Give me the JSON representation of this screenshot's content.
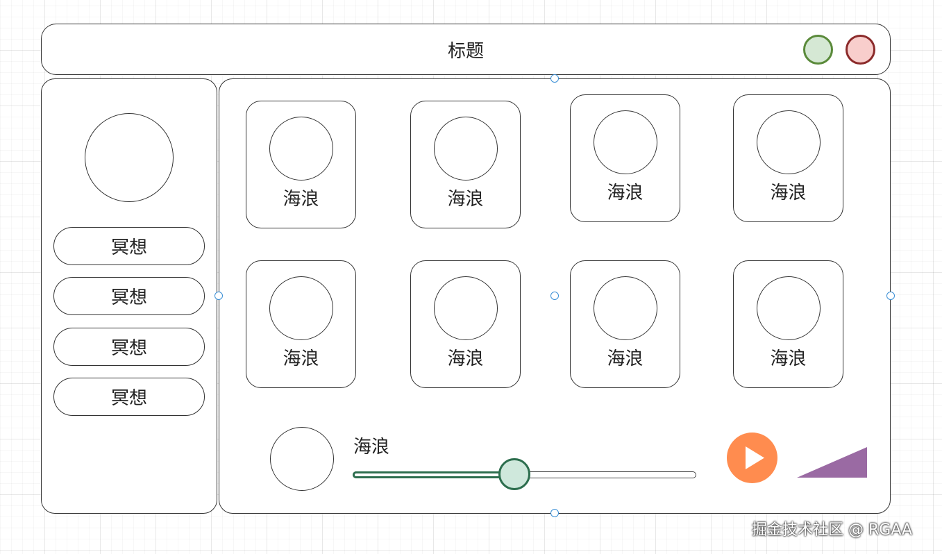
{
  "window": {
    "title": "标题",
    "controls": [
      {
        "name": "maximize",
        "icon": "green-circle-button"
      },
      {
        "name": "close",
        "icon": "red-circle-button"
      }
    ]
  },
  "sidebar": {
    "avatar_icon": "avatar-circle",
    "items": [
      {
        "label": "冥想"
      },
      {
        "label": "冥想"
      },
      {
        "label": "冥想"
      },
      {
        "label": "冥想"
      }
    ]
  },
  "cards": [
    {
      "label": "海浪"
    },
    {
      "label": "海浪"
    },
    {
      "label": "海浪"
    },
    {
      "label": "海浪"
    },
    {
      "label": "海浪"
    },
    {
      "label": "海浪"
    },
    {
      "label": "海浪"
    },
    {
      "label": "海浪"
    }
  ],
  "player": {
    "track_title": "海浪",
    "progress": 0.47,
    "play_icon": "play-icon",
    "volume_icon": "volume-icon"
  },
  "colors": {
    "maximize_fill": "#d5e8d4",
    "maximize_border": "#5a8a3a",
    "close_fill": "#f8cecc",
    "close_border": "#8b2a2a",
    "slider_accent": "#2d6e4e",
    "slider_thumb": "#cfe8dc",
    "play_button": "#ff8c4f",
    "volume": "#9a6aa3"
  },
  "watermark": "掘金技术社区 @ RGAA"
}
